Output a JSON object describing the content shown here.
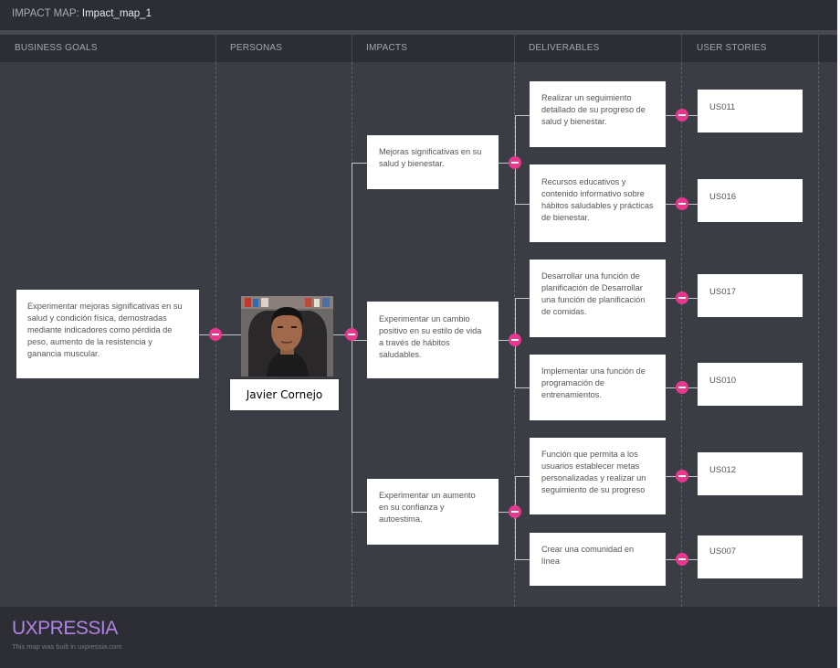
{
  "header": {
    "prefix": "IMPACT MAP:",
    "map_name": "Impact_map_1"
  },
  "columns": [
    "BUSINESS GOALS",
    "PERSONAS",
    "IMPACTS",
    "DELIVERABLES",
    "USER STORIES"
  ],
  "business_goal": "Experimentar mejoras significativas en su salud y condición física, demostradas mediante indicadores como pérdida de peso, aumento de la resistencia y ganancia muscular.",
  "persona": {
    "name": "Javier Cornejo"
  },
  "impacts": [
    "Mejoras significativas en su salud y bienestar.",
    "Experimentar un cambio positivo en su estilo de vida a través de hábitos saludables.",
    "Experimentar un aumento en su confianza y autoestima."
  ],
  "deliverables": [
    "Realizar un seguimiento detallado de su progreso de salud y bienestar.",
    "Recursos educativos y contenido informativo sobre hábitos saludables y prácticas de bienestar.",
    "Desarrollar una función de planificación de  Desarrollar una función de planificación de comidas.",
    "Implementar una función de programación de entrenamientos.",
    "Función que permita a los usuarios establecer metas personalizadas y realizar un seguimiento de su progreso",
    "Crear una comunidad en línea"
  ],
  "user_stories": [
    "US011",
    "US016",
    "US017",
    "US010",
    "US012",
    "US007"
  ],
  "footer": {
    "logo": "UXPRESSIA",
    "note": "This map was built in uxpressia.com"
  },
  "colors": {
    "accent_dot": "#e8388d",
    "logo": "#b282e8",
    "background": "#3b3d44",
    "header": "#2c2e34"
  }
}
